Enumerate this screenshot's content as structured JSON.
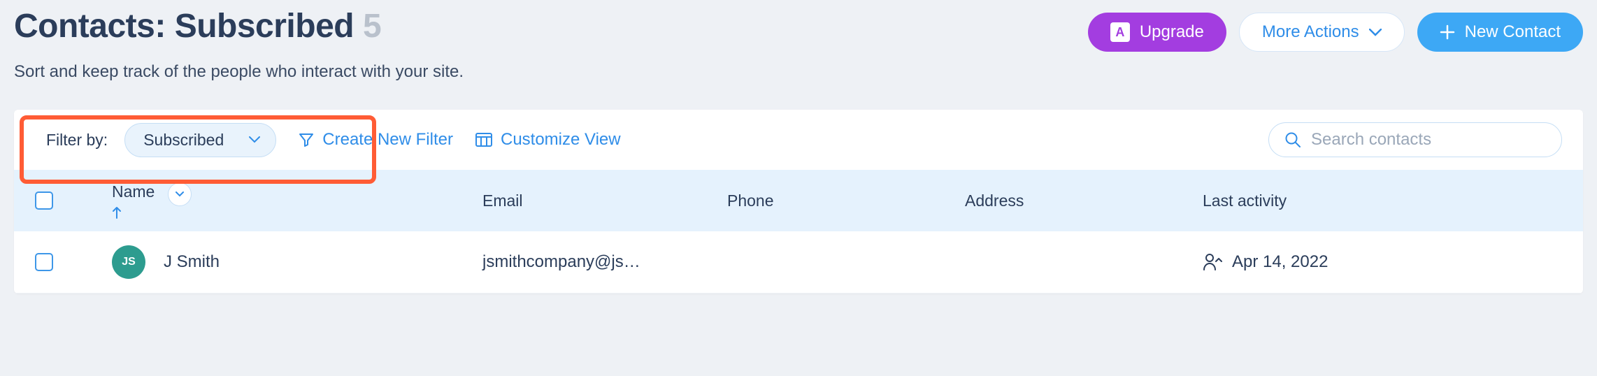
{
  "header": {
    "title_prefix": "Contacts: ",
    "title_filter": "Subscribed",
    "count": "5",
    "subtitle": "Sort and keep track of the people who interact with your site."
  },
  "actions": {
    "upgrade": "Upgrade",
    "more": "More Actions",
    "new_contact": "New Contact"
  },
  "toolbar": {
    "filter_label": "Filter by:",
    "filter_value": "Subscribed",
    "create_filter": "Create New Filter",
    "customize_view": "Customize View",
    "search_placeholder": "Search contacts"
  },
  "columns": {
    "name": "Name",
    "email": "Email",
    "phone": "Phone",
    "address": "Address",
    "last_activity": "Last activity"
  },
  "rows": [
    {
      "initials": "JS",
      "name": "J Smith",
      "email": "jsmithcompany@js…",
      "phone": "",
      "address": "",
      "last_activity": "Apr 14, 2022"
    }
  ]
}
